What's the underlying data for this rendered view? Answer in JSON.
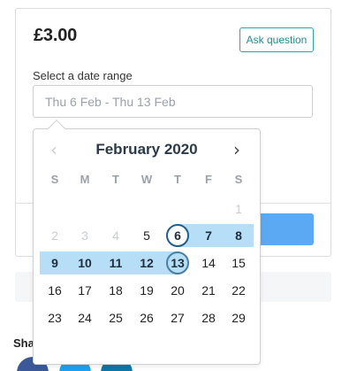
{
  "listing": {
    "price": "£3.00",
    "ask_question": "Ask question",
    "date_range_label": "Select a date range",
    "date_range_value": "Thu 6 Feb - Thu 13 Feb"
  },
  "share": {
    "label": "Share",
    "icons": [
      "facebook-icon",
      "twitter-icon",
      "linkedin-icon"
    ]
  },
  "calendar": {
    "month_label": "February 2020",
    "prev_icon": "chevron-left-icon",
    "next_icon": "chevron-right-icon",
    "weekdays": [
      "S",
      "M",
      "T",
      "W",
      "T",
      "F",
      "S"
    ],
    "weeks": [
      [
        "",
        "",
        "",
        "",
        "",
        "",
        "1"
      ],
      [
        "2",
        "3",
        "4",
        "5",
        "6",
        "7",
        "8"
      ],
      [
        "9",
        "10",
        "11",
        "12",
        "13",
        "14",
        "15"
      ],
      [
        "16",
        "17",
        "18",
        "19",
        "20",
        "21",
        "22"
      ],
      [
        "23",
        "24",
        "25",
        "26",
        "27",
        "28",
        "29"
      ]
    ],
    "disabled_days": [
      "1",
      "2",
      "3",
      "4"
    ],
    "range_start": "6",
    "range_end": "13",
    "colors": {
      "range_fill": "#b6def7",
      "accent_ring": "#1f5f8b",
      "primary_button": "#5aa9f2",
      "outline_button": "#2aa6b0"
    }
  }
}
